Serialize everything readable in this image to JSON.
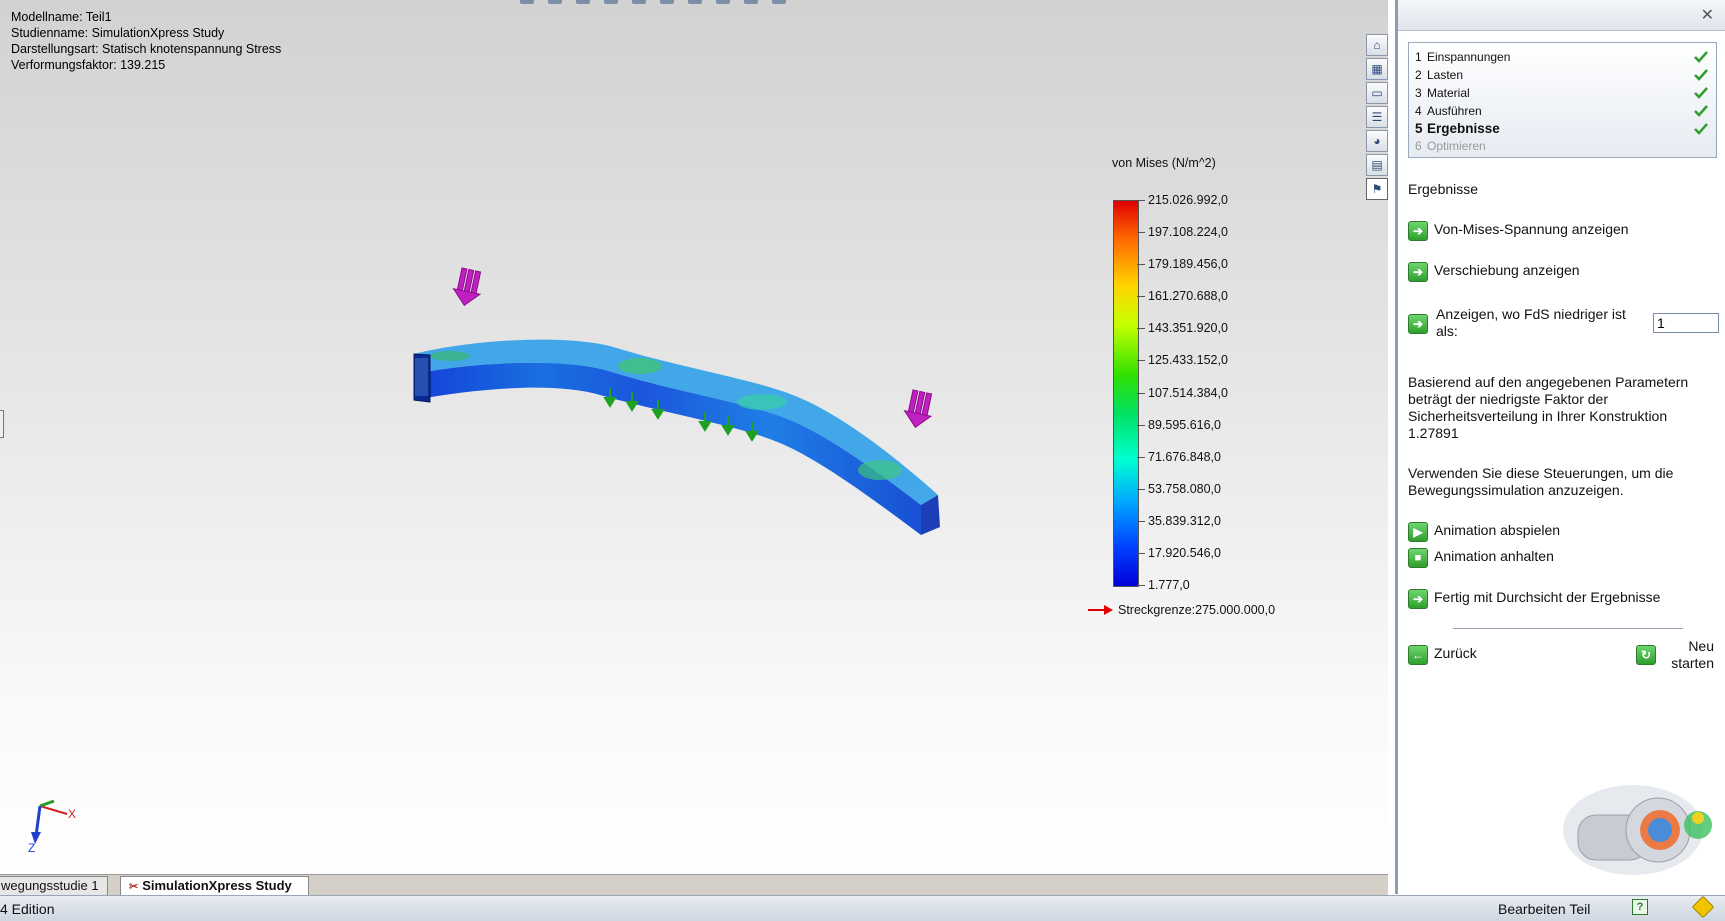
{
  "model_info": {
    "model_name": "Modellname: Teil1",
    "study_name": "Studienname: SimulationXpress Study",
    "display_type": "Darstellungsart: Statisch knotenspannung Stress",
    "deformation": "Verformungsfaktor: 139.215"
  },
  "legend": {
    "title": "von Mises (N/m^2)",
    "labels": [
      "215.026.992,0",
      "197.108.224,0",
      "179.189.456,0",
      "161.270.688,0",
      "143.351.920,0",
      "125.433.152,0",
      "107.514.384,0",
      "89.595.616,0",
      "71.676.848,0",
      "53.758.080,0",
      "35.839.312,0",
      "17.920.546,0",
      "1.777,0"
    ],
    "yield": "Streckgrenze:275.000.000,0"
  },
  "side_icons": [
    "home-icon",
    "part-icon",
    "folder-icon",
    "property-icon",
    "appearance-icon",
    "design-library-icon",
    "simulation-icon"
  ],
  "triad": {
    "x_label": "X",
    "z_label": "Z"
  },
  "tabs": {
    "motion_study": "wegungsstudie 1",
    "simulation_study": "SimulationXpress Study"
  },
  "status": {
    "edition": "4 Edition",
    "mode": "Bearbeiten Teil",
    "help": "?"
  },
  "panel": {
    "steps": [
      {
        "num": "1",
        "label": "Einspannungen",
        "done": true
      },
      {
        "num": "2",
        "label": "Lasten",
        "done": true
      },
      {
        "num": "3",
        "label": "Material",
        "done": true
      },
      {
        "num": "4",
        "label": "Ausführen",
        "done": true
      },
      {
        "num": "5",
        "label": "Ergebnisse",
        "done": true
      },
      {
        "num": "6",
        "label": "Optimieren",
        "done": false
      }
    ],
    "heading": "Ergebnisse",
    "show_von_mises": "Von-Mises-Spannung anzeigen",
    "show_displacement": "Verschiebung anzeigen",
    "show_fos_label": "Anzeigen, wo FdS niedriger ist als:",
    "fos_value": "1",
    "result_text": "Basierend auf den angegebenen Parametern beträgt der niedrigste Faktor der Sicherheitsverteilung in Ihrer Konstruktion 1.27891",
    "animation_text": "Verwenden Sie diese Steuerungen, um die Bewegungssimulation anzuzeigen.",
    "play_animation": "Animation abspielen",
    "stop_animation": "Animation anhalten",
    "done_results": "Fertig mit Durchsicht der Ergebnisse",
    "back": "Zurück",
    "restart": "Neu starten"
  },
  "colors": {
    "panel_border": "#8d9cb0",
    "accent_green": "#2e9e2e",
    "yield_red": "#e00000"
  }
}
